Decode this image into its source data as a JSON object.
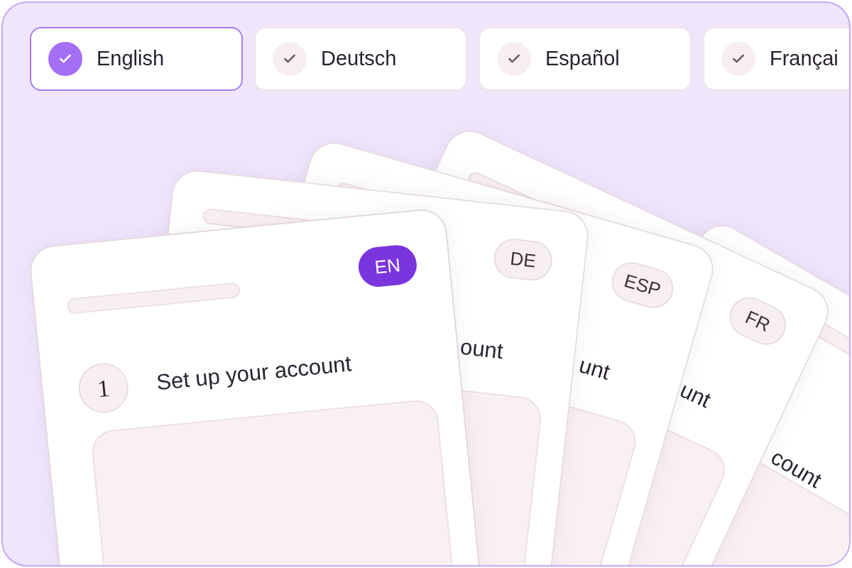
{
  "tabs": [
    {
      "label": "English",
      "selected": true
    },
    {
      "label": "Deutsch",
      "selected": false
    },
    {
      "label": "Español",
      "selected": false
    },
    {
      "label": "Françai",
      "selected": false
    }
  ],
  "cards": [
    {
      "title": "count"
    },
    {
      "badge": "FR",
      "title": "unt",
      "active": false
    },
    {
      "badge": "ESP",
      "title": "unt",
      "active": false
    },
    {
      "badge": "DE",
      "title": "ount",
      "active": false
    },
    {
      "badge": "EN",
      "step": "1",
      "title": "Set up your account",
      "active": true
    }
  ]
}
